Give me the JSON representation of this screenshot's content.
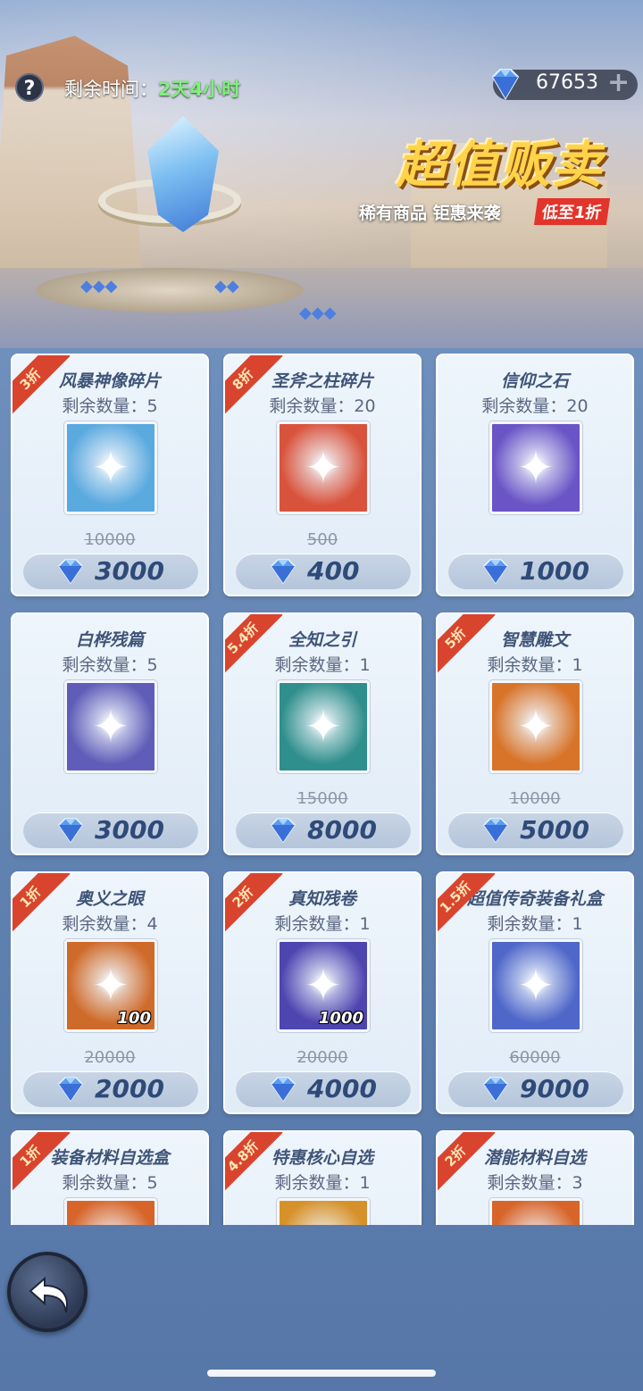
{
  "header": {
    "help_label": "?",
    "timer_label": "剩余时间：",
    "timer_value": "2天4小时",
    "currency_value": "67653",
    "currency_plus": "+",
    "title": "超值贩卖",
    "subtitle": "稀有商品 钜惠来袭",
    "sale_badge": "低至1折"
  },
  "colors": {
    "accent_red": "#d9442e",
    "title_gold": "#ffd34a",
    "timer_green": "#7ef07b",
    "price_text": "#2e4a78"
  },
  "items": [
    {
      "name": "风暴神像碎片",
      "remain": "剩余数量：5",
      "discount": "3折",
      "old_price": "10000",
      "price": "3000",
      "qty": "",
      "icon": "statue-shard-icon",
      "bg": "#5aa9df"
    },
    {
      "name": "圣斧之柱碎片",
      "remain": "剩余数量：20",
      "discount": "8折",
      "old_price": "500",
      "price": "400",
      "qty": "",
      "icon": "axe-pillar-shard-icon",
      "bg": "#d9533c"
    },
    {
      "name": "信仰之石",
      "remain": "剩余数量：20",
      "discount": "",
      "old_price": "",
      "price": "1000",
      "qty": "",
      "icon": "faith-stone-icon",
      "bg": "#6a55c6"
    },
    {
      "name": "白桦残篇",
      "remain": "剩余数量：5",
      "discount": "",
      "old_price": "",
      "price": "3000",
      "qty": "",
      "icon": "birch-fragment-icon",
      "bg": "#5f5db8"
    },
    {
      "name": "全知之引",
      "remain": "剩余数量：1",
      "discount": "5.4折",
      "old_price": "15000",
      "price": "8000",
      "qty": "",
      "icon": "omniscience-orb-icon",
      "bg": "#2f8f8c"
    },
    {
      "name": "智慧雕文",
      "remain": "剩余数量：1",
      "discount": "5折",
      "old_price": "10000",
      "price": "5000",
      "qty": "",
      "icon": "wisdom-glyph-icon",
      "bg": "#d8742a"
    },
    {
      "name": "奥义之眼",
      "remain": "剩余数量：4",
      "discount": "1折",
      "old_price": "20000",
      "price": "2000",
      "qty": "100",
      "icon": "mystic-eye-icon",
      "bg": "#cf6b2a"
    },
    {
      "name": "真知残卷",
      "remain": "剩余数量：1",
      "discount": "2折",
      "old_price": "20000",
      "price": "4000",
      "qty": "1000",
      "icon": "truth-scroll-icon",
      "bg": "#4d45b0"
    },
    {
      "name": "超值传奇装备礼盒",
      "remain": "剩余数量：1",
      "discount": "1.5折",
      "old_price": "60000",
      "price": "9000",
      "qty": "",
      "icon": "legendary-gear-box-icon",
      "bg": "#4f67c9"
    },
    {
      "name": "装备材料自选盒",
      "remain": "剩余数量：5",
      "discount": "1折",
      "old_price": "",
      "price": "",
      "qty": "",
      "icon": "gear-material-box-icon",
      "bg": "#d7652a"
    },
    {
      "name": "特惠核心自选",
      "remain": "剩余数量：1",
      "discount": "4.8折",
      "old_price": "",
      "price": "",
      "qty": "",
      "icon": "core-select-icon",
      "bg": "#d7912a"
    },
    {
      "name": "潜能材料自选",
      "remain": "剩余数量：3",
      "discount": "2折",
      "old_price": "",
      "price": "",
      "qty": "",
      "icon": "potential-material-icon",
      "bg": "#d7652a"
    }
  ]
}
